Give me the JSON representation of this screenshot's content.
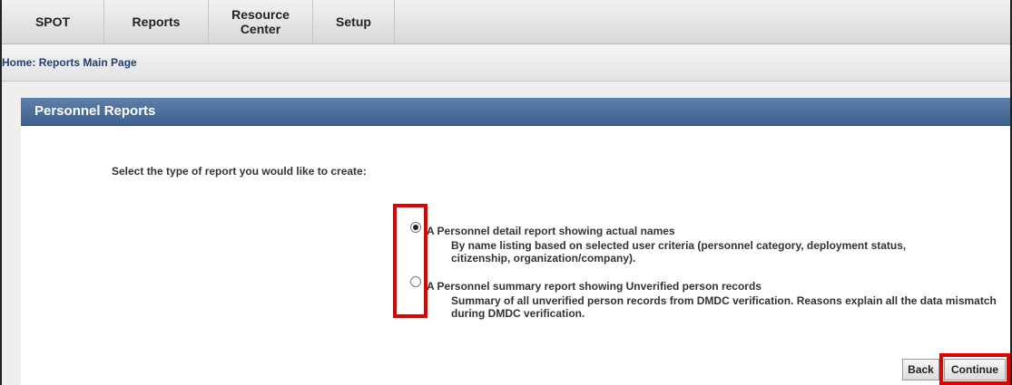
{
  "nav": {
    "items": [
      {
        "label": "SPOT"
      },
      {
        "label": "Reports"
      },
      {
        "label": "Resource Center"
      },
      {
        "label": "Setup"
      }
    ]
  },
  "breadcrumb": {
    "home": "Home",
    "separator": ":",
    "current": "Reports Main Page"
  },
  "panel": {
    "title": "Personnel Reports",
    "prompt": "Select the type of report you would like to create:"
  },
  "options": [
    {
      "title": "A Personnel detail report showing actual names",
      "description": "By name listing based on selected user criteria (personnel category, deployment status, citizenship, organization/company).",
      "selected": true
    },
    {
      "title": "A Personnel summary report showing Unverified person records",
      "description": "Summary of all unverified person records from DMDC verification. Reasons explain all the data mismatch during DMDC verification.",
      "selected": false
    }
  ],
  "buttons": {
    "back": "Back",
    "continue": "Continue"
  },
  "colors": {
    "panel_header": "#3e618e",
    "highlight": "#e00000",
    "breadcrumb_link": "#1f3f73"
  }
}
